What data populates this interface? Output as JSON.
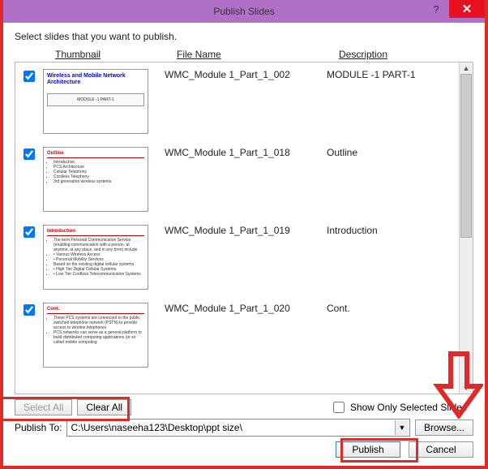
{
  "window": {
    "title": "Publish Slides",
    "help_symbol": "?",
    "close_symbol": "✕"
  },
  "instruction": "Select slides that you want to publish.",
  "columns": {
    "thumbnail": "Thumbnail",
    "filename": "File Name",
    "description": "Description"
  },
  "slides": [
    {
      "checked": true,
      "filename": "WMC_Module 1_Part_1_002",
      "description": "MODULE -1 PART-1",
      "thumb_kind": "title",
      "thumb_title": "Wireless and Mobile Network Architecture",
      "thumb_box": "MODULE -1 PART-1"
    },
    {
      "checked": true,
      "filename": "WMC_Module 1_Part_1_018",
      "description": "Outline",
      "thumb_kind": "bullets",
      "thumb_heading": "Outline",
      "thumb_bullets": [
        "Introduction",
        "PCS Architecture",
        "Cellular Telephony",
        "Cordless Telephony",
        "3rd generation wireless systems"
      ]
    },
    {
      "checked": true,
      "filename": "WMC_Module 1_Part_1_019",
      "description": "Introduction",
      "thumb_kind": "bullets",
      "thumb_heading": "Introduction",
      "thumb_bullets": [
        "The term Personal Communication Service (enabling communication with a person, at anytime, at any place, and in any form) include",
        " • Various Wireless Access",
        " • Personal Mobility Services",
        "Based on the existing digital cellular systems",
        " • High Tier Digital Cellular Systems",
        " • Low Tier Cordless Telecommunication Systems"
      ]
    },
    {
      "checked": true,
      "filename": "WMC_Module 1_Part_1_020",
      "description": "Cont.",
      "thumb_kind": "bullets",
      "thumb_heading": "Cont.",
      "thumb_bullets": [
        "These PCS systems are connected to the public switched telephone network (PSTN) to provide access to wireline telephones",
        "PCS networks can serve as a general platform to build distributed computing applications (or so called mobile computing"
      ]
    }
  ],
  "buttons": {
    "select_all": "Select All",
    "clear_all": "Clear All",
    "show_only_selected": "Show Only Selected Slides",
    "browse": "Browse...",
    "publish": "Publish",
    "cancel": "Cancel"
  },
  "publish_to": {
    "label": "Publish To:",
    "value": "C:\\Users\\naseeha123\\Desktop\\ppt size\\"
  },
  "show_only_checked": false
}
